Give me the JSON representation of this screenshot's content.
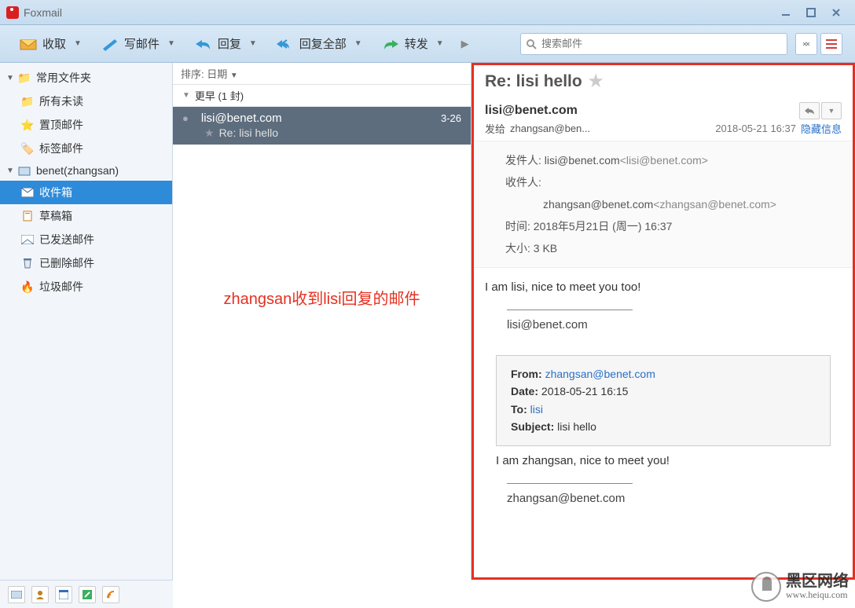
{
  "app": {
    "title": "Foxmail"
  },
  "toolbar": {
    "receive": "收取",
    "compose": "写邮件",
    "reply": "回复",
    "replyAll": "回复全部",
    "forward": "转发",
    "searchPlaceholder": "搜索邮件"
  },
  "sidebar": {
    "commonFolders": "常用文件夹",
    "allUnread": "所有未读",
    "pinned": "置顶邮件",
    "tagged": "标签邮件",
    "account": "benet(zhangsan)",
    "inbox": "收件箱",
    "drafts": "草稿箱",
    "sent": "已发送邮件",
    "deleted": "已删除邮件",
    "junk": "垃圾邮件"
  },
  "list": {
    "sortLabel": "排序: 日期",
    "groupEarlier": "更早 (1 封)",
    "msgFrom": "lisi@benet.com",
    "msgDate": "3-26",
    "msgSubject": "Re: lisi hello",
    "annotation": "zhangsan收到lisi回复的邮件"
  },
  "preview": {
    "subject": "Re: lisi hello",
    "from": "lisi@benet.com",
    "sentToLabel": "发给",
    "sentTo": "zhangsan@ben...",
    "datetime": "2018-05-21 16:37",
    "hideInfo": "隐藏信息",
    "details": {
      "senderLabel": "发件人:",
      "senderName": "lisi@benet.com",
      "senderAddr": "<lisi@benet.com>",
      "recipLabel": "收件人:",
      "recipName": "zhangsan@benet.com",
      "recipAddr": "<zhangsan@benet.com>",
      "timeLabel": "时间:",
      "timeVal": "2018年5月21日 (周一) 16:37",
      "sizeLabel": "大小:",
      "sizeVal": "3 KB"
    },
    "body": "I am lisi, nice to meet you too!",
    "signature": "lisi@benet.com",
    "quoted": {
      "fromLabel": "From:",
      "fromVal": "zhangsan@benet.com",
      "dateLabel": "Date:",
      "dateVal": "2018-05-21 16:15",
      "toLabel": "To:",
      "toVal": "lisi",
      "subjLabel": "Subject:",
      "subjVal": "lisi hello",
      "body": "I am zhangsan, nice to meet you!",
      "signature": "zhangsan@benet.com"
    }
  },
  "watermark": {
    "text": "黑区网络",
    "url": "www.heiqu.com"
  }
}
